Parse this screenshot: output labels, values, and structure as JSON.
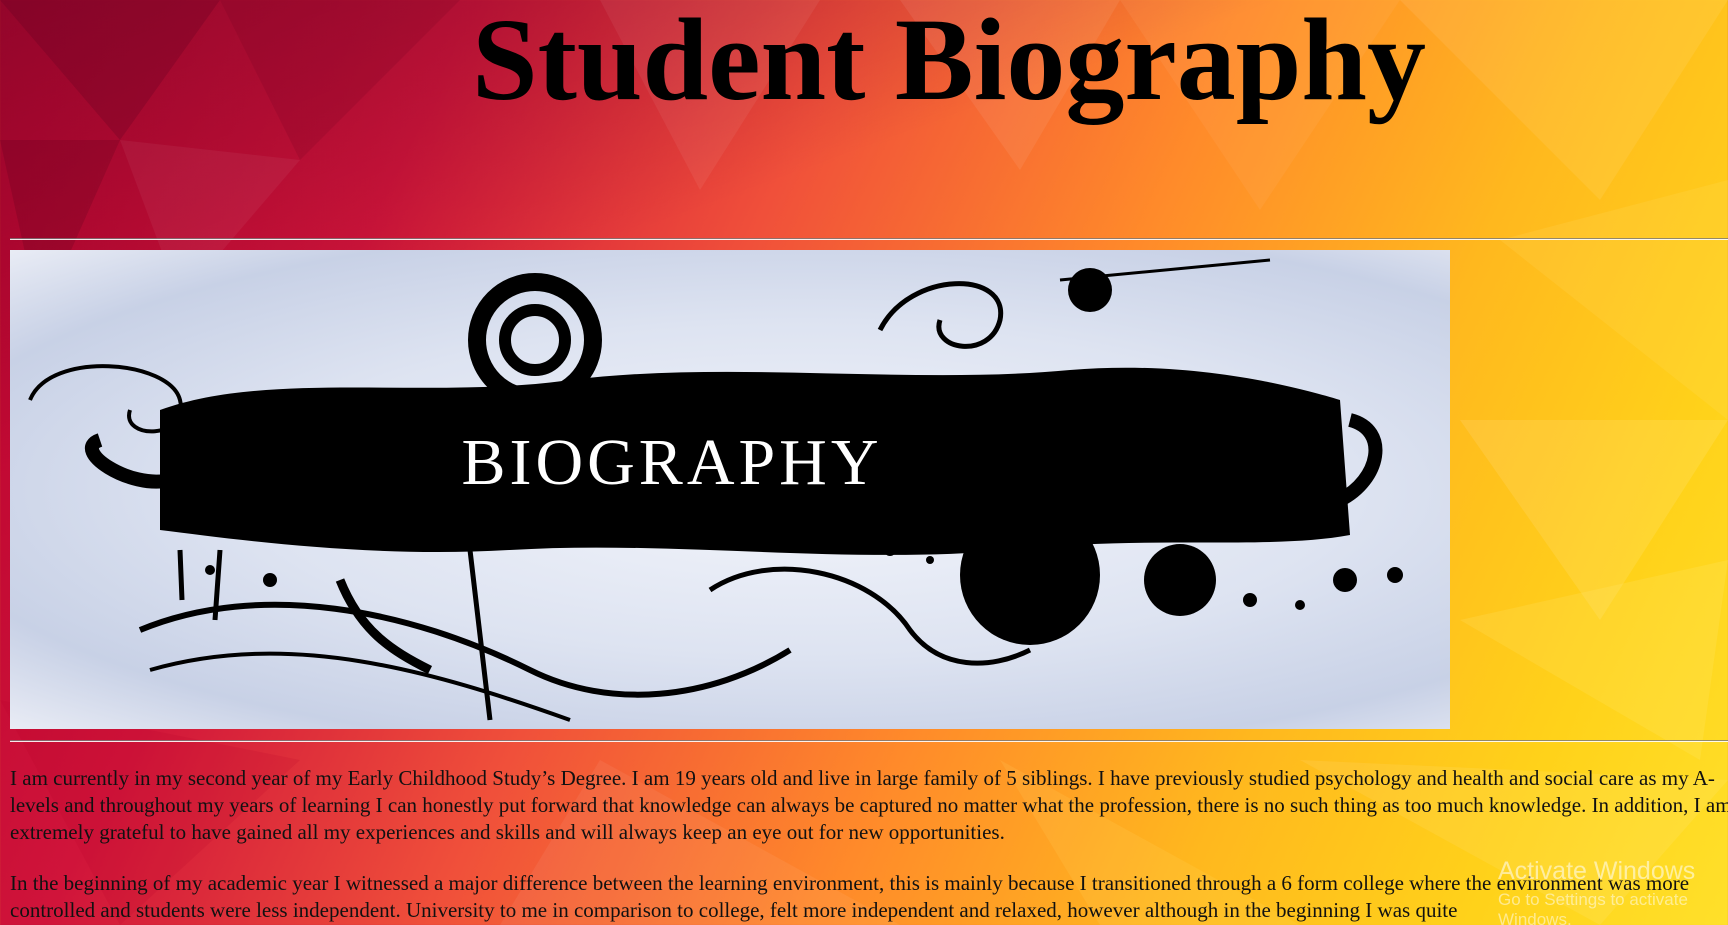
{
  "page": {
    "title": "Student Biography"
  },
  "banner": {
    "text": "BIOGRAPHY"
  },
  "bio": {
    "paragraphs": [
      "I am currently in my second year of my Early Childhood Study’s Degree. I am 19 years old and live in large family of 5 siblings. I have previously studied psychology and health and social care as my A-levels and throughout my years of learning I can honestly put forward that knowledge can always be captured no matter what the profession, there is no such thing as too much knowledge. In addition, I am extremely grateful to have gained all my experiences and skills and will always keep an eye out for new opportunities.",
      "In the beginning of my academic year I witnessed a major difference between the learning environment, this is mainly because I transitioned through a 6 form college where the environment was more controlled and students were less independent. University to me in comparison to college, felt more independent and relaxed, however although in the beginning I was quite"
    ]
  },
  "overlay": {
    "watermark": "Activate Windows",
    "watermark_sub": "Go to Settings to activate Windows."
  },
  "colors": {
    "background_start": "#b5002e",
    "background_end": "#ffe02a",
    "title": "#000000",
    "banner_text": "#ffffff"
  }
}
